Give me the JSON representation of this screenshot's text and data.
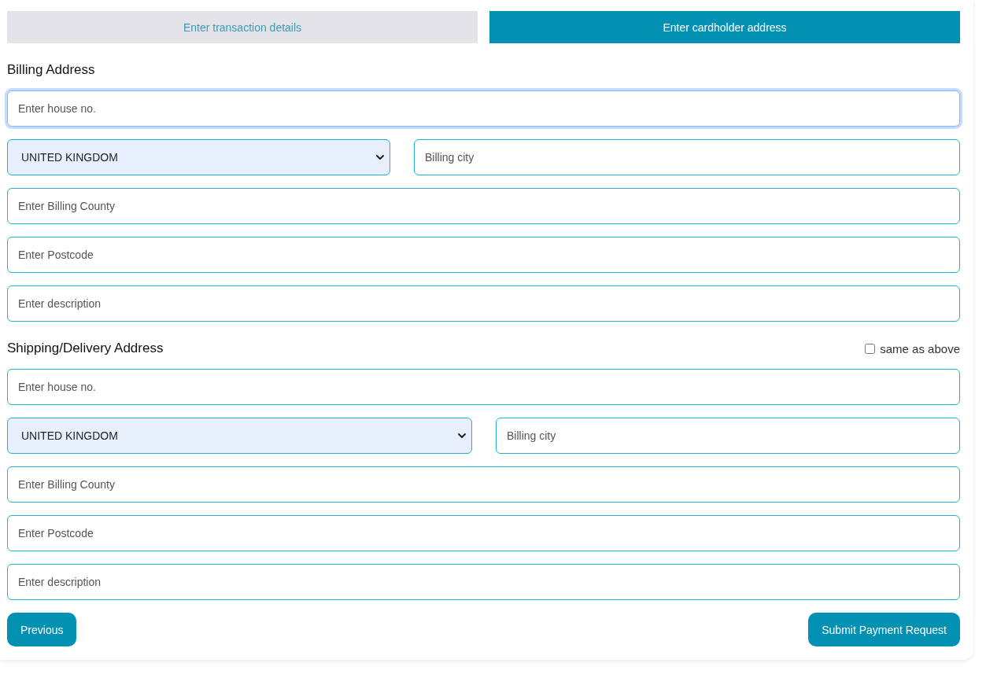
{
  "tabs": [
    {
      "label": "Enter transaction details",
      "selected": false
    },
    {
      "label": "Enter cardholder address",
      "selected": true
    }
  ],
  "sections": [
    {
      "title": "Billing Address",
      "fields": [
        {
          "kind": "text",
          "placeholder": "Enter house no.",
          "focused": true
        },
        {
          "kind": "row",
          "items": [
            {
              "kind": "select",
              "value": "UNITED KINGDOM"
            },
            {
              "kind": "text",
              "placeholder": "Billing city",
              "focused": false
            }
          ]
        },
        {
          "kind": "text",
          "placeholder": "Enter Billing County",
          "focused": false
        },
        {
          "kind": "text",
          "placeholder": "Enter Postcode",
          "focused": false
        },
        {
          "kind": "text",
          "placeholder": "Enter description",
          "focused": false
        }
      ]
    },
    {
      "title": "Shipping/Delivery Address",
      "option": {
        "label": "same as above",
        "checked": false
      },
      "fields": [
        {
          "kind": "text",
          "placeholder": "Enter house no.",
          "focused": false
        },
        {
          "kind": "row",
          "items": [
            {
              "kind": "select",
              "value": "UNITED KINGDOM"
            },
            {
              "kind": "text",
              "placeholder": "Billing city",
              "focused": false
            }
          ]
        },
        {
          "kind": "text",
          "placeholder": "Enter Billing County",
          "focused": false
        },
        {
          "kind": "text",
          "placeholder": "Enter Postcode",
          "focused": false
        },
        {
          "kind": "text",
          "placeholder": "Enter description",
          "focused": false
        }
      ]
    }
  ],
  "buttons": [
    "Previous",
    "Submit Payment Request"
  ]
}
